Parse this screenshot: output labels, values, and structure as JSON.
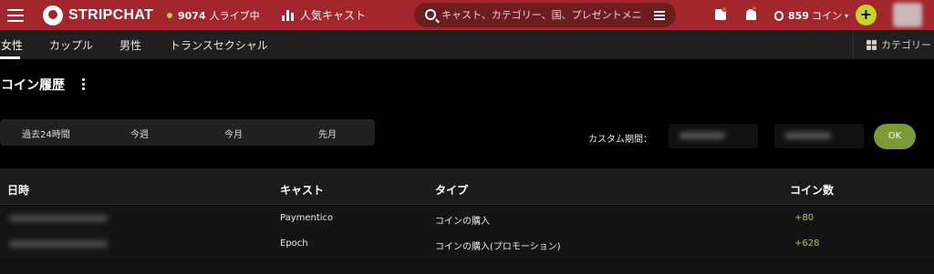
{
  "header": {
    "brand": "STRIPCHAT",
    "live_count": "9074",
    "live_label": "人ライブ中",
    "popular_label": "人気キャスト",
    "search_placeholder": "キャスト、カテゴリー、国、プレゼントメニュ",
    "coins_amount": "859",
    "coins_label": "コイン",
    "caret": "▾",
    "add_symbol": "+",
    "accent_color": "#a2262b",
    "icons": [
      "menu-icon",
      "logo-icon",
      "live-dot-icon",
      "popular-icon",
      "search-icon",
      "filter-icon",
      "messages-icon",
      "bell-icon",
      "coins-icon",
      "add-icon",
      "avatar"
    ]
  },
  "tabs": {
    "items": [
      "女性",
      "カップル",
      "男性",
      "トランスセクシャル"
    ],
    "active": "女性",
    "categories_label": "カテゴリー"
  },
  "page": {
    "title": "コイン履歴",
    "periods": [
      "過去24時間",
      "今週",
      "今月",
      "先月"
    ],
    "custom_period_label": "カスタム期間：",
    "ok_label": "OK",
    "ok_color": "#7a9a3a"
  },
  "table": {
    "headers": [
      "日時",
      "キャスト",
      "タイプ",
      "コイン数"
    ],
    "rows": [
      {
        "cast": "Paymentico",
        "type": "コインの購入",
        "coins": "+80"
      },
      {
        "cast": "Epoch",
        "type": "コインの購入(プロモーション)",
        "coins": "+628"
      }
    ],
    "positive_color": "#a8cf3c"
  }
}
